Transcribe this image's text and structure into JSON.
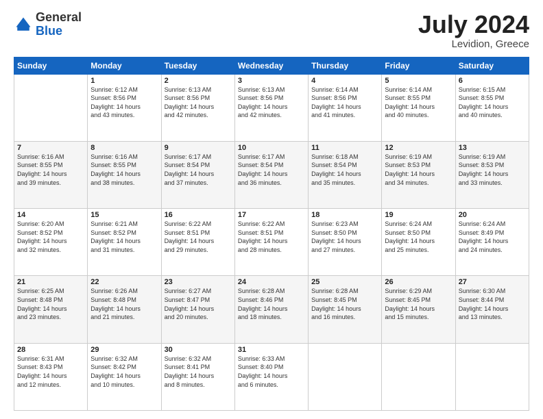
{
  "header": {
    "logo": {
      "general": "General",
      "blue": "Blue"
    },
    "title": "July 2024",
    "location": "Levidion, Greece"
  },
  "weekdays": [
    "Sunday",
    "Monday",
    "Tuesday",
    "Wednesday",
    "Thursday",
    "Friday",
    "Saturday"
  ],
  "weeks": [
    [
      {
        "day": "",
        "info": ""
      },
      {
        "day": "1",
        "info": "Sunrise: 6:12 AM\nSunset: 8:56 PM\nDaylight: 14 hours\nand 43 minutes."
      },
      {
        "day": "2",
        "info": "Sunrise: 6:13 AM\nSunset: 8:56 PM\nDaylight: 14 hours\nand 42 minutes."
      },
      {
        "day": "3",
        "info": "Sunrise: 6:13 AM\nSunset: 8:56 PM\nDaylight: 14 hours\nand 42 minutes."
      },
      {
        "day": "4",
        "info": "Sunrise: 6:14 AM\nSunset: 8:56 PM\nDaylight: 14 hours\nand 41 minutes."
      },
      {
        "day": "5",
        "info": "Sunrise: 6:14 AM\nSunset: 8:55 PM\nDaylight: 14 hours\nand 40 minutes."
      },
      {
        "day": "6",
        "info": "Sunrise: 6:15 AM\nSunset: 8:55 PM\nDaylight: 14 hours\nand 40 minutes."
      }
    ],
    [
      {
        "day": "7",
        "info": "Sunrise: 6:16 AM\nSunset: 8:55 PM\nDaylight: 14 hours\nand 39 minutes."
      },
      {
        "day": "8",
        "info": "Sunrise: 6:16 AM\nSunset: 8:55 PM\nDaylight: 14 hours\nand 38 minutes."
      },
      {
        "day": "9",
        "info": "Sunrise: 6:17 AM\nSunset: 8:54 PM\nDaylight: 14 hours\nand 37 minutes."
      },
      {
        "day": "10",
        "info": "Sunrise: 6:17 AM\nSunset: 8:54 PM\nDaylight: 14 hours\nand 36 minutes."
      },
      {
        "day": "11",
        "info": "Sunrise: 6:18 AM\nSunset: 8:54 PM\nDaylight: 14 hours\nand 35 minutes."
      },
      {
        "day": "12",
        "info": "Sunrise: 6:19 AM\nSunset: 8:53 PM\nDaylight: 14 hours\nand 34 minutes."
      },
      {
        "day": "13",
        "info": "Sunrise: 6:19 AM\nSunset: 8:53 PM\nDaylight: 14 hours\nand 33 minutes."
      }
    ],
    [
      {
        "day": "14",
        "info": "Sunrise: 6:20 AM\nSunset: 8:52 PM\nDaylight: 14 hours\nand 32 minutes."
      },
      {
        "day": "15",
        "info": "Sunrise: 6:21 AM\nSunset: 8:52 PM\nDaylight: 14 hours\nand 31 minutes."
      },
      {
        "day": "16",
        "info": "Sunrise: 6:22 AM\nSunset: 8:51 PM\nDaylight: 14 hours\nand 29 minutes."
      },
      {
        "day": "17",
        "info": "Sunrise: 6:22 AM\nSunset: 8:51 PM\nDaylight: 14 hours\nand 28 minutes."
      },
      {
        "day": "18",
        "info": "Sunrise: 6:23 AM\nSunset: 8:50 PM\nDaylight: 14 hours\nand 27 minutes."
      },
      {
        "day": "19",
        "info": "Sunrise: 6:24 AM\nSunset: 8:50 PM\nDaylight: 14 hours\nand 25 minutes."
      },
      {
        "day": "20",
        "info": "Sunrise: 6:24 AM\nSunset: 8:49 PM\nDaylight: 14 hours\nand 24 minutes."
      }
    ],
    [
      {
        "day": "21",
        "info": "Sunrise: 6:25 AM\nSunset: 8:48 PM\nDaylight: 14 hours\nand 23 minutes."
      },
      {
        "day": "22",
        "info": "Sunrise: 6:26 AM\nSunset: 8:48 PM\nDaylight: 14 hours\nand 21 minutes."
      },
      {
        "day": "23",
        "info": "Sunrise: 6:27 AM\nSunset: 8:47 PM\nDaylight: 14 hours\nand 20 minutes."
      },
      {
        "day": "24",
        "info": "Sunrise: 6:28 AM\nSunset: 8:46 PM\nDaylight: 14 hours\nand 18 minutes."
      },
      {
        "day": "25",
        "info": "Sunrise: 6:28 AM\nSunset: 8:45 PM\nDaylight: 14 hours\nand 16 minutes."
      },
      {
        "day": "26",
        "info": "Sunrise: 6:29 AM\nSunset: 8:45 PM\nDaylight: 14 hours\nand 15 minutes."
      },
      {
        "day": "27",
        "info": "Sunrise: 6:30 AM\nSunset: 8:44 PM\nDaylight: 14 hours\nand 13 minutes."
      }
    ],
    [
      {
        "day": "28",
        "info": "Sunrise: 6:31 AM\nSunset: 8:43 PM\nDaylight: 14 hours\nand 12 minutes."
      },
      {
        "day": "29",
        "info": "Sunrise: 6:32 AM\nSunset: 8:42 PM\nDaylight: 14 hours\nand 10 minutes."
      },
      {
        "day": "30",
        "info": "Sunrise: 6:32 AM\nSunset: 8:41 PM\nDaylight: 14 hours\nand 8 minutes."
      },
      {
        "day": "31",
        "info": "Sunrise: 6:33 AM\nSunset: 8:40 PM\nDaylight: 14 hours\nand 6 minutes."
      },
      {
        "day": "",
        "info": ""
      },
      {
        "day": "",
        "info": ""
      },
      {
        "day": "",
        "info": ""
      }
    ]
  ]
}
